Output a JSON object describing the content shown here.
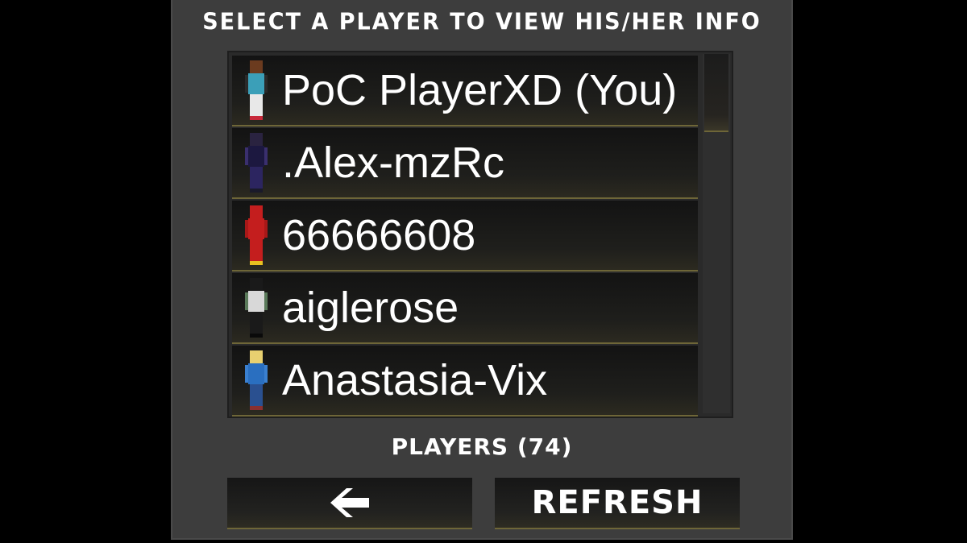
{
  "title": "SELECT A PLAYER TO VIEW HIS/HER INFO",
  "players": [
    {
      "name": "PoC PlayerXD (You)",
      "skin": {
        "head": "#6b3b1f",
        "body": "#3b9fb8",
        "arms": "#2a2a2a",
        "legs": "#e8e8e8",
        "shoe": "#c8283a"
      }
    },
    {
      "name": ".Alex-mzRc",
      "skin": {
        "head": "#2a2340",
        "body": "#1c1840",
        "arms": "#3a2f6e",
        "legs": "#2c2560",
        "shoe": "#1a1a2a"
      }
    },
    {
      "name": "66666608",
      "skin": {
        "head": "#c41e1e",
        "body": "#c41e1e",
        "arms": "#a81818",
        "legs": "#c41e1e",
        "shoe": "#e8c020"
      }
    },
    {
      "name": "aiglerose",
      "skin": {
        "head": "#1a1a1a",
        "body": "#d8d8d8",
        "arms": "#5a7a5a",
        "legs": "#1a1a1a",
        "shoe": "#0a0a0a"
      }
    },
    {
      "name": "Anastasia-Vix",
      "skin": {
        "head": "#e8d070",
        "body": "#2a6fc0",
        "arms": "#3a80d0",
        "legs": "#2a5090",
        "shoe": "#8a3030"
      }
    }
  ],
  "players_count_label": "PLAYERS (74)",
  "back_button": {
    "icon": "arrow-left-icon"
  },
  "refresh_button": {
    "label": "REFRESH"
  }
}
